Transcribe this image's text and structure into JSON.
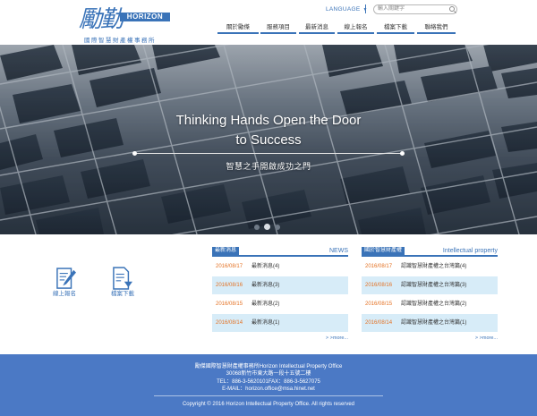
{
  "header": {
    "logo": {
      "mark": "勵勤",
      "brand": "HORIZON",
      "subtitle": "國際智慧財產權事務所"
    },
    "language_label": "LANGUAGE",
    "search_placeholder": "輸入關鍵字",
    "nav": [
      {
        "label": "關於勵傑"
      },
      {
        "label": "服務項目"
      },
      {
        "label": "最新消息"
      },
      {
        "label": "線上報名"
      },
      {
        "label": "檔案下載"
      },
      {
        "label": "聯絡我們"
      }
    ]
  },
  "hero": {
    "title": "Thinking Hands Open the Door\nto Success",
    "subtitle": "智慧之手開啟成功之門",
    "slides": 3,
    "active_slide": 2
  },
  "quick_links": [
    {
      "label": "線上報名",
      "icon": "pencil-form-icon"
    },
    {
      "label": "檔案下載",
      "icon": "download-document-icon"
    }
  ],
  "news_panel": {
    "tag": "最新消息",
    "en": "NEWS",
    "items": [
      {
        "date": "2016/08/17",
        "title": "最新消息(4)"
      },
      {
        "date": "2016/08/16",
        "title": "最新消息(3)"
      },
      {
        "date": "2016/08/15",
        "title": "最新消息(2)"
      },
      {
        "date": "2016/08/14",
        "title": "最新消息(1)"
      }
    ],
    "more": "> >more..."
  },
  "ip_panel": {
    "tag": "國於智慧財產權",
    "en": "Intellectual property",
    "items": [
      {
        "date": "2016/08/17",
        "title": "認識智慧財產權之台灣篇(4)"
      },
      {
        "date": "2016/08/16",
        "title": "認識智慧財產權之台灣篇(3)"
      },
      {
        "date": "2016/08/15",
        "title": "認識智慧財產權之台灣篇(2)"
      },
      {
        "date": "2016/08/14",
        "title": "認識智慧財產權之台灣篇(1)"
      }
    ],
    "more": "> >more..."
  },
  "footer": {
    "company": "勵傑國際智慧財產權事務所Horizon Intellectual Property Office",
    "address": "30068新竹市東大路一段十五號二樓",
    "phone": "TEL：886-3-5620101FAX：886-3-5627075",
    "email": "E-MAIL：horizon.office@msa.hinet.net",
    "copyright": "Copyright © 2016 Horizon Intellectual Property Office. All rights reserved"
  },
  "colors": {
    "accent": "#3a73b8",
    "footer": "#4b79c5",
    "date": "#e47224",
    "row_alt": "#d7ecf8"
  }
}
